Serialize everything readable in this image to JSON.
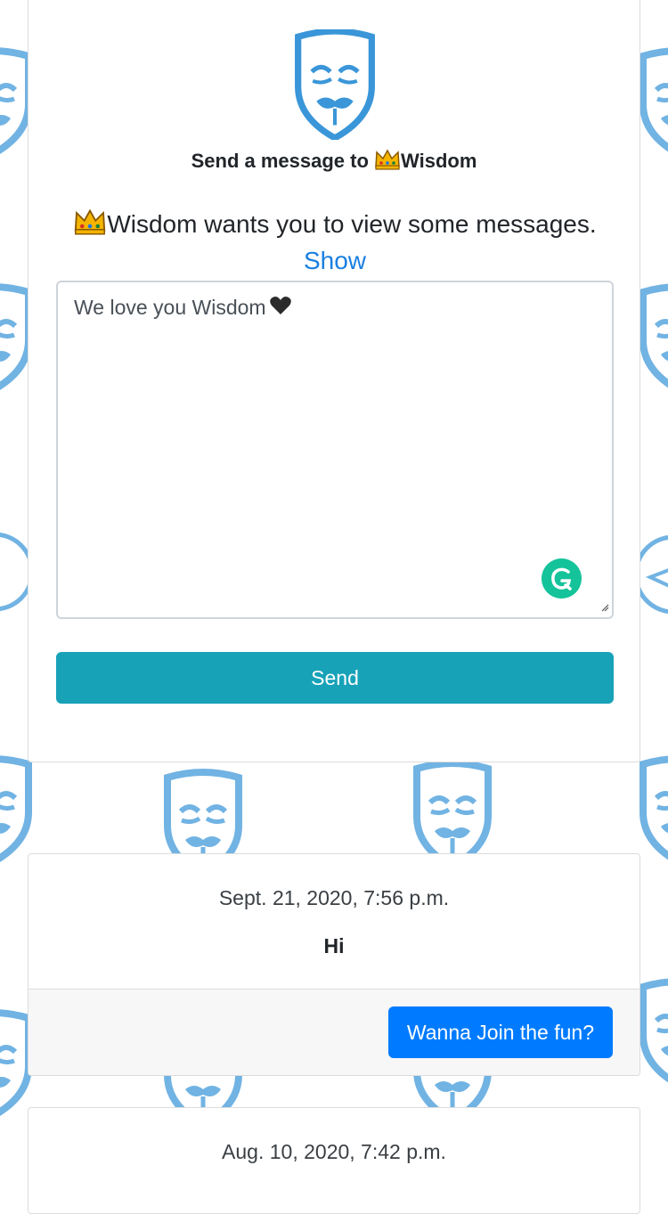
{
  "colors": {
    "accent_blue": "#3a96d8",
    "send_button": "#17a2b8",
    "join_button": "#007bff",
    "link": "#1a7fe0",
    "grammarly": "#15c39a"
  },
  "icons": {
    "logo": "anonymous-mask-icon",
    "crown": "crown-emoji-icon",
    "heart": "black-heart-emoji-icon",
    "grammarly": "grammarly-icon"
  },
  "header": {
    "title_prefix": "Send a message to ",
    "recipient": "Wisdom"
  },
  "prompt": {
    "recipient": "Wisdom",
    "text": " wants you to view some messages. ",
    "link": "Show"
  },
  "composer": {
    "value": "We love you Wisdom",
    "send_label": "Send"
  },
  "messages": [
    {
      "date": "Sept. 21, 2020, 7:56 p.m.",
      "text": "Hi",
      "action_label": "Wanna Join the fun?"
    },
    {
      "date": "Aug. 10, 2020, 7:42 p.m."
    }
  ]
}
